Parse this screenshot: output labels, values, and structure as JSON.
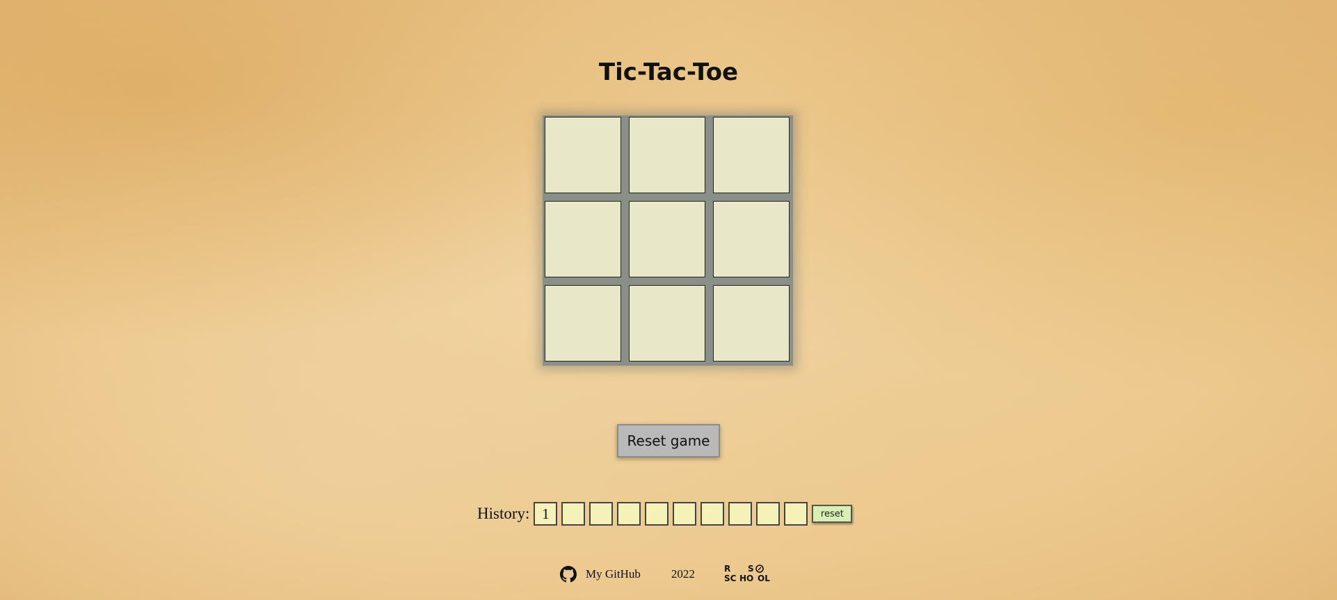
{
  "title": "Tic-Tac-Toe",
  "board": {
    "cells": [
      "",
      "",
      "",
      "",
      "",
      "",
      "",
      "",
      ""
    ]
  },
  "reset_game_label": "Reset game",
  "history": {
    "label": "History:",
    "steps": [
      "1",
      "",
      "",
      "",
      "",
      "",
      "",
      "",
      "",
      ""
    ],
    "reset_label": "reset"
  },
  "footer": {
    "github_text": "My GitHub",
    "year": "2022",
    "logo_icon": "rs-school-logo",
    "github_icon": "github-icon"
  },
  "colors": {
    "cell_bg": "#e8e8c8",
    "board_bg": "#8a8f88",
    "history_box_bg": "#f6f1b8",
    "history_reset_bg": "#d8efb4",
    "reset_button_bg": "#b9b9b9"
  }
}
